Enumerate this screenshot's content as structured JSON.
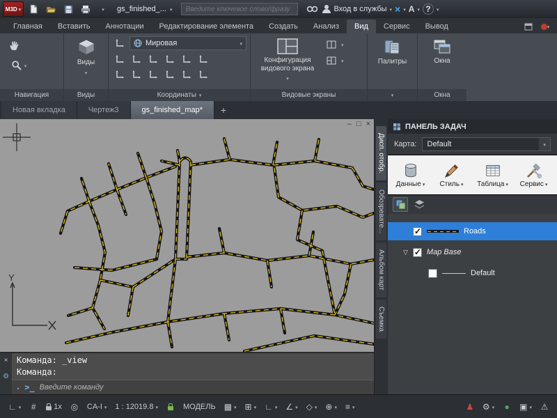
{
  "titlebar": {
    "logo_text": "М3D",
    "filename": "gs_finished_...",
    "search_placeholder": "Введите ключевое слово/фразу",
    "signin_label": "Вход в службы",
    "help_label": "?",
    "a_logo": "A"
  },
  "ribbon": {
    "tabs": [
      "Главная",
      "Вставить",
      "Аннотации",
      "Редактирование элемента",
      "Создать",
      "Анализ",
      "Вид",
      "Сервис",
      "Вывод"
    ],
    "active_tab": "Вид",
    "panels": {
      "navigation": {
        "label": "Навигация"
      },
      "views": {
        "label": "Виды",
        "button_label": "Виды"
      },
      "coordinates": {
        "label": "Координаты",
        "dropdown_value": "Мировая",
        "ucs_icon_count": 12
      },
      "viewports": {
        "label": "Видовые экраны",
        "button_label": "Конфигурация видового экрана"
      },
      "palettes": {
        "label": "Палитры",
        "button_label": "Палитры"
      },
      "windows": {
        "label": "Окна",
        "button_label": "Окна"
      }
    }
  },
  "doc_tabs": {
    "tabs": [
      {
        "label": "Новая вкладка",
        "active": false
      },
      {
        "label": "Чертеж3",
        "active": false
      },
      {
        "label": "gs_finished_map*",
        "active": true
      }
    ],
    "add_label": "+"
  },
  "viewport": {
    "minimize": "–",
    "restore": "□",
    "close": "×",
    "axis_y_label": "Y"
  },
  "task_pane": {
    "title": "ПАНЕЛЬ ЗАДАЧ",
    "map_label": "Карта:",
    "map_value": "Default",
    "toolbar": [
      {
        "label": "Данные",
        "icon": "database-icon"
      },
      {
        "label": "Стиль",
        "icon": "style-brush-icon"
      },
      {
        "label": "Таблица",
        "icon": "table-icon"
      },
      {
        "label": "Сервис",
        "icon": "tools-icon"
      }
    ],
    "layers": [
      {
        "name": "Roads",
        "checked": true,
        "selected": true
      },
      {
        "name": "Map Base",
        "checked": true,
        "italic": true
      },
      {
        "name": "Default",
        "checked": false
      }
    ],
    "side_tabs": [
      {
        "label": "Дисп. отобр.",
        "active": true
      },
      {
        "label": "Обозревате...",
        "active": false
      },
      {
        "label": "Альбом карт",
        "active": false
      },
      {
        "label": "Съемка",
        "active": false
      }
    ]
  },
  "command": {
    "history": [
      "Команда: _view",
      "Команда:"
    ],
    "placeholder": "Введите команду"
  },
  "statusbar": {
    "items_left": [
      {
        "name": "drafting-settings-button",
        "glyph": "∟",
        "caret": true
      },
      {
        "name": "snap-grid-button",
        "glyph": "#",
        "caret": false
      },
      {
        "name": "viewport-scale-button",
        "label": "1x",
        "lock": true,
        "caret": false
      },
      {
        "name": "geo-status-button",
        "glyph": "◎",
        "caret": false
      },
      {
        "name": "coordinate-system-button",
        "label": "CA-I",
        "caret": true
      },
      {
        "name": "map-scale-button",
        "label": "1 : 12019.8",
        "caret": true
      },
      {
        "name": "scale-lock-button",
        "lockgreen": true
      },
      {
        "name": "model-space-button",
        "label": "МОДЕЛЬ"
      },
      {
        "name": "grid-display-button",
        "glyph": "▦",
        "caret": true
      },
      {
        "name": "snap-mode-button",
        "glyph": "⊞",
        "caret": true
      },
      {
        "name": "ortho-button",
        "glyph": "∟",
        "caret": true
      },
      {
        "name": "polar-tracking-button",
        "glyph": "∠",
        "caret": true
      },
      {
        "name": "isodraft-button",
        "glyph": "◇",
        "caret": true
      },
      {
        "name": "object-snap-button",
        "glyph": "⊕",
        "caret": true
      },
      {
        "name": "lineweight-button",
        "glyph": "≡",
        "caret": true
      }
    ],
    "items_right": [
      {
        "name": "trace-user-button",
        "glyph": "♟",
        "color": "#d1483e"
      },
      {
        "name": "workspace-gear-button",
        "glyph": "⚙",
        "caret": true
      },
      {
        "name": "status-ok-dot",
        "glyph": "●",
        "color": "#58a55c"
      },
      {
        "name": "ui-overflow-button",
        "glyph": "▣",
        "caret": true
      },
      {
        "name": "isolate-warning-button",
        "glyph": "⚠"
      }
    ]
  },
  "map": {
    "background": "#9c9c9c",
    "road_casing_color": "#151515",
    "road_dash_color": "#e8c41f",
    "roads": [
      "M258,61 L252,201",
      "M274,61 L268,201",
      "M258,61 Q266,50 274,61",
      "M252,201 L268,201",
      "M255,45 L258,61",
      "M258,66 L232,60",
      "M274,66 L330,58 L392,66 L452,60 L506,70",
      "M330,58 L322,28",
      "M392,66 L398,33",
      "M452,60 L458,29",
      "M506,70 L521,96 L537,101",
      "M394,70 L400,112 L434,131 L484,125 L521,141 L537,135",
      "M434,131 L427,173 L463,189",
      "M268,198 L322,192 L384,203 L444,196 L504,208 L537,202",
      "M322,192 L315,157",
      "M384,203 L390,241",
      "M444,196 L450,162",
      "M252,68 L210,84 L168,101 L128,118 L97,132",
      "M210,84 L198,49",
      "M168,101 L156,64",
      "M128,118 L117,85",
      "M210,84 L222,121",
      "M168,101 L181,137",
      "M128,118 L141,152",
      "M97,132 L87,164",
      "M141,152 L151,191 L144,231",
      "M222,121 L232,161 L225,201",
      "M107,213 L161,217 L225,201",
      "M144,231 L133,271 L150,301",
      "M144,231 L191,241 L252,201",
      "M191,241 L184,282",
      "M133,271 L98,282",
      "M95,321 L161,306 L241,291 L322,279 L403,272 L481,281 L537,293",
      "M241,291 L247,327",
      "M322,279 L329,317",
      "M403,272 L409,307",
      "M351,333 L451,311 L537,323",
      "M252,201 L246,250 L241,291",
      "M504,208 L495,251 L481,281",
      "M463,189 L471,231 L481,281"
    ]
  }
}
